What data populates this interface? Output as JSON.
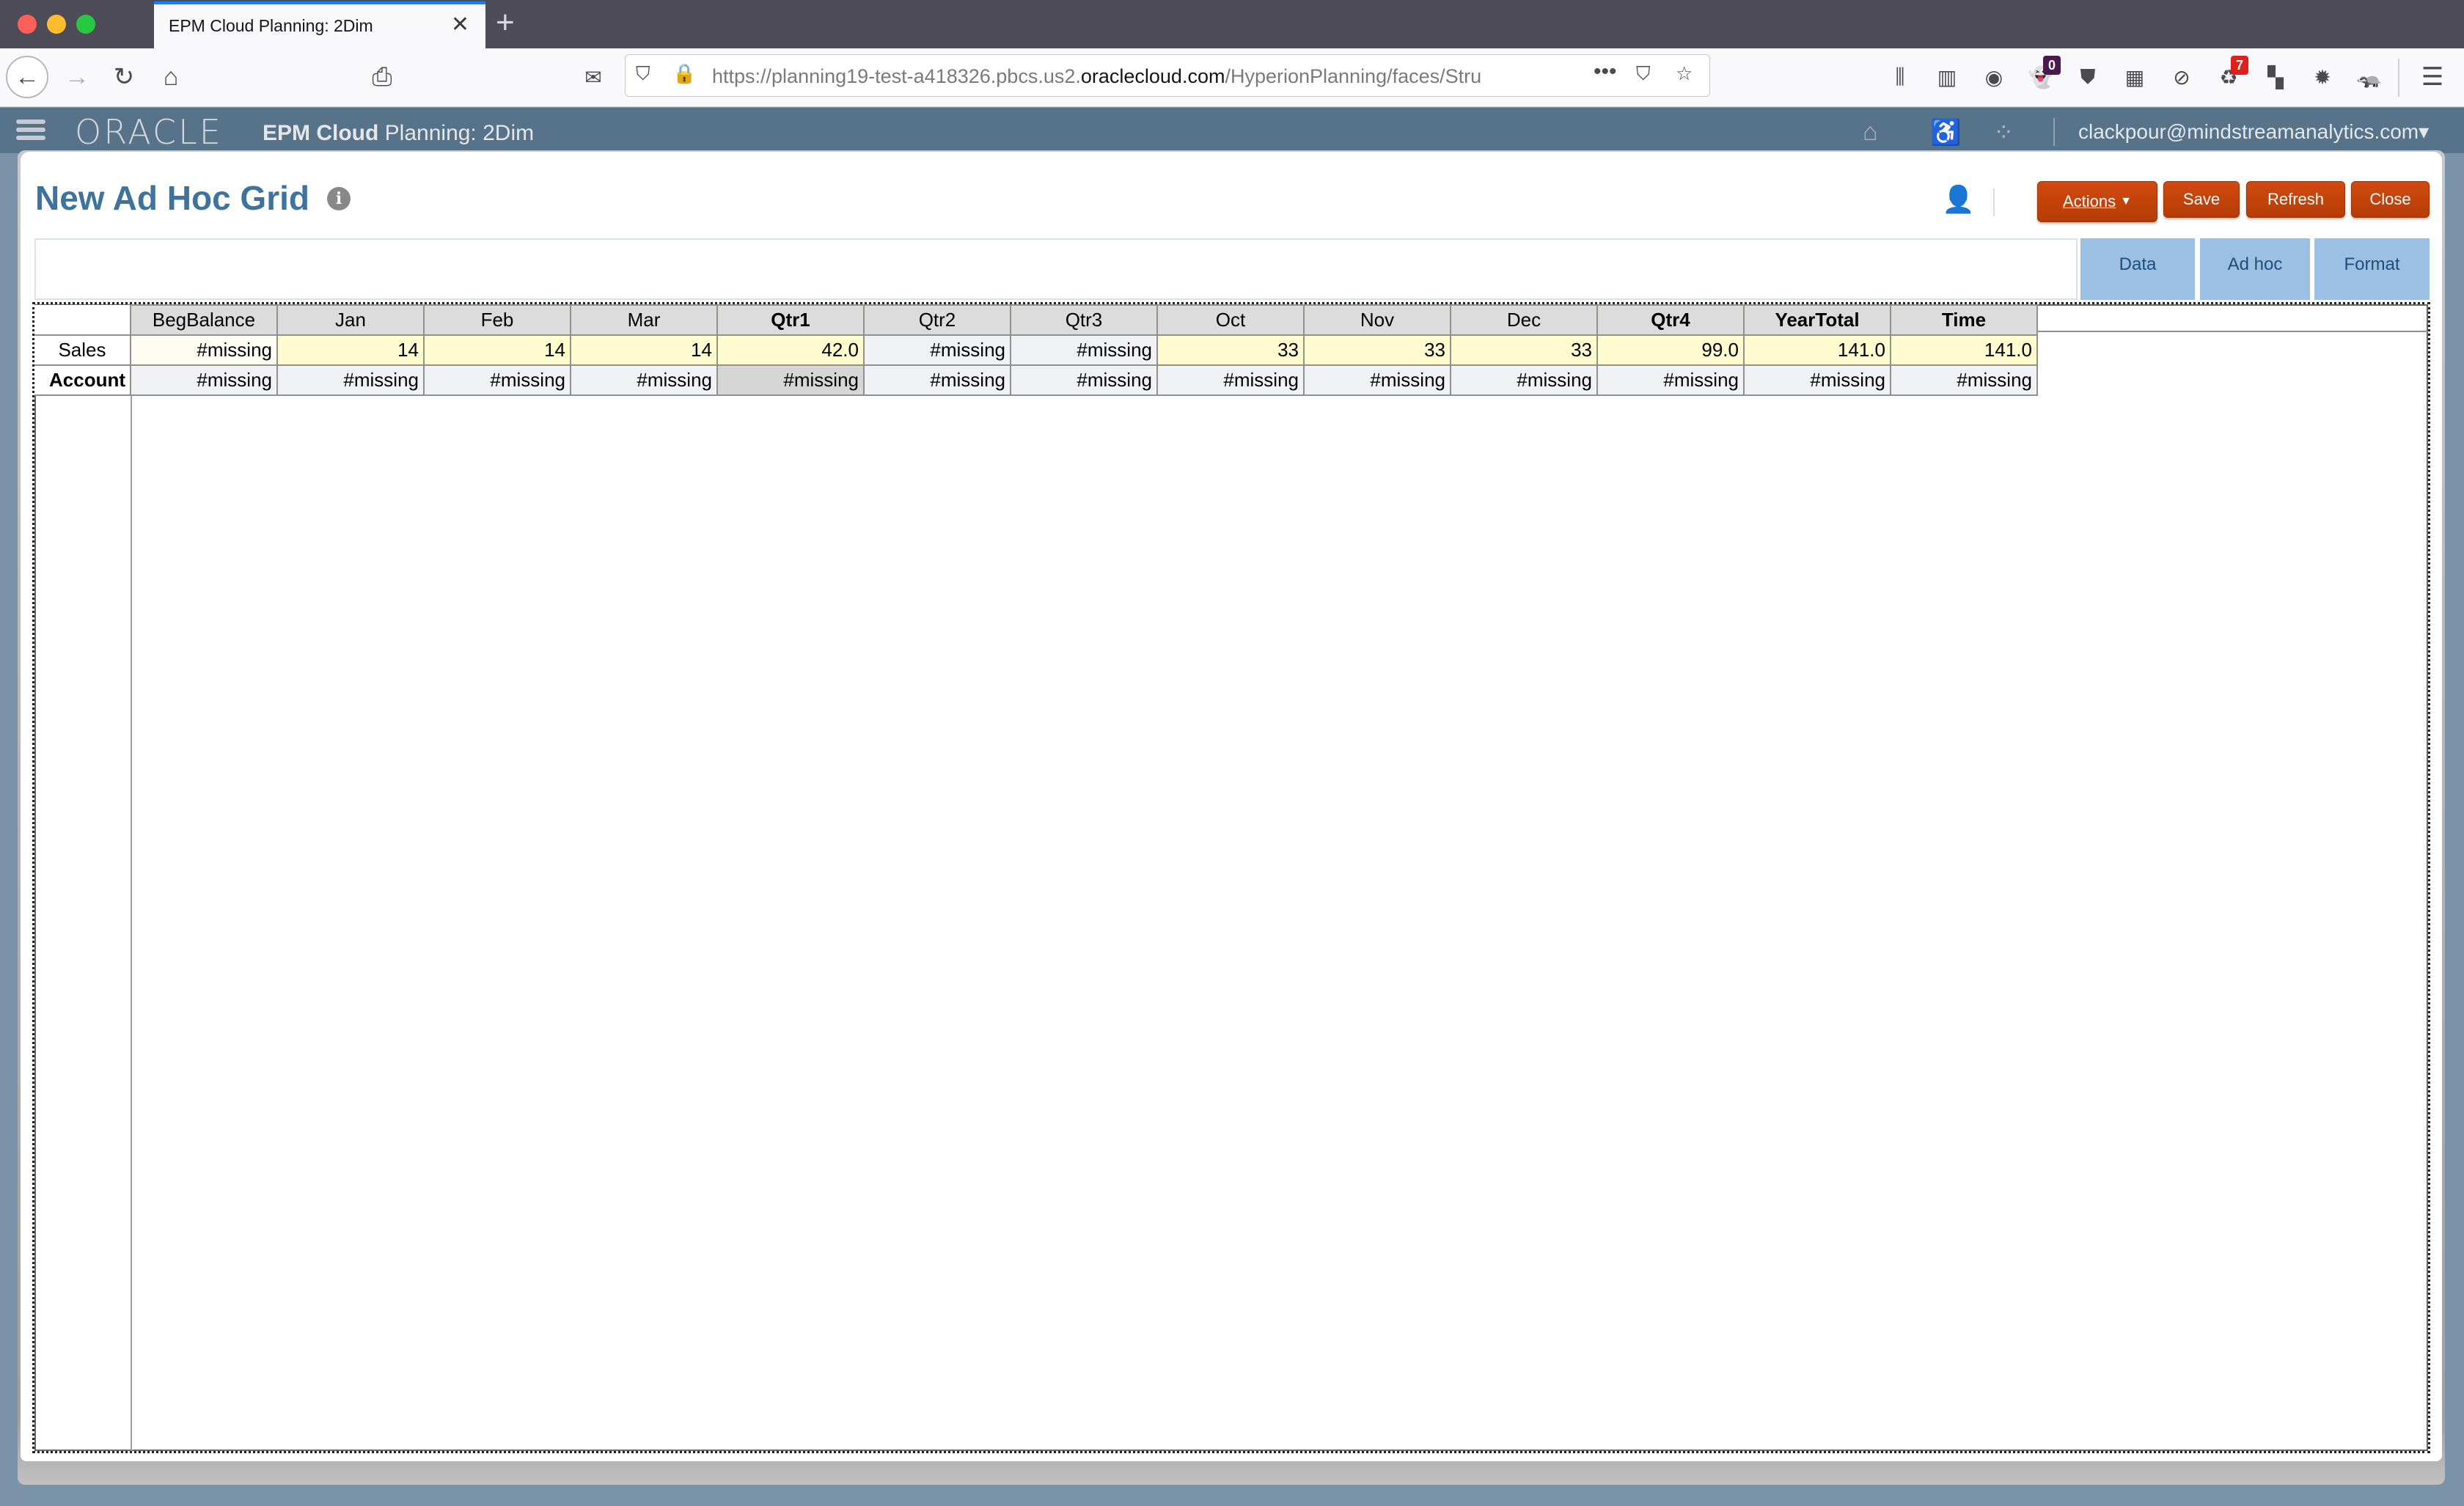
{
  "browser": {
    "tab_title": "EPM Cloud Planning: 2Dim",
    "url_prefix": "https://planning19-test-a418326.pbcs.us2.",
    "url_domain": "oraclecloud.com",
    "url_suffix": "/HyperionPlanning/faces/Stru",
    "extensions": [
      {
        "name": "library-icon",
        "glyph": "⫼"
      },
      {
        "name": "sidebar-icon",
        "glyph": "▥"
      },
      {
        "name": "account-icon",
        "glyph": "◉"
      },
      {
        "name": "ghostery-icon",
        "glyph": "👻",
        "badge": "0",
        "badge_color": "#4a1a4f"
      },
      {
        "name": "ublock-icon",
        "glyph": "⛊"
      },
      {
        "name": "sheets-icon",
        "glyph": "▦"
      },
      {
        "name": "video-blocker-icon",
        "glyph": "⊘"
      },
      {
        "name": "recycle-icon",
        "glyph": "♻",
        "badge": "7",
        "badge_color": "#e0201c"
      },
      {
        "name": "apps-add-icon",
        "glyph": "▚"
      },
      {
        "name": "settings-icon",
        "glyph": "✹"
      },
      {
        "name": "privacy-badger-icon",
        "glyph": "🦡"
      }
    ]
  },
  "header": {
    "logo": "ORACLE",
    "app_bold": "EPM Cloud",
    "app_name": "Planning: 2Dim",
    "user": "clackpour@mindstreamanalytics.com",
    "user_caret": "▾"
  },
  "page": {
    "title": "New Ad Hoc Grid",
    "info_glyph": "i",
    "buttons": {
      "actions": "Actions",
      "save": "Save",
      "refresh": "Refresh",
      "close": "Close"
    },
    "side_tabs": {
      "data": "Data",
      "adhoc": "Ad hoc",
      "format": "Format"
    }
  },
  "grid": {
    "columns": [
      {
        "label": "BegBalance",
        "bold": false
      },
      {
        "label": "Jan",
        "bold": false
      },
      {
        "label": "Feb",
        "bold": false
      },
      {
        "label": "Mar",
        "bold": false
      },
      {
        "label": "Qtr1",
        "bold": true
      },
      {
        "label": "Qtr2",
        "bold": false
      },
      {
        "label": "Qtr3",
        "bold": false
      },
      {
        "label": "Oct",
        "bold": false
      },
      {
        "label": "Nov",
        "bold": false
      },
      {
        "label": "Dec",
        "bold": false
      },
      {
        "label": "Qtr4",
        "bold": true
      },
      {
        "label": "YearTotal",
        "bold": true
      },
      {
        "label": "Time",
        "bold": true
      }
    ],
    "rows": [
      {
        "label": "Sales",
        "bold": false,
        "cells": [
          "#missing",
          "14",
          "14",
          "14",
          "42.0",
          "#missing",
          "#missing",
          "33",
          "33",
          "33",
          "99.0",
          "141.0",
          "141.0"
        ]
      },
      {
        "label": "Account",
        "bold": true,
        "cells": [
          "#missing",
          "#missing",
          "#missing",
          "#missing",
          "#missing",
          "#missing",
          "#missing",
          "#missing",
          "#missing",
          "#missing",
          "#missing",
          "#missing",
          "#missing"
        ]
      }
    ]
  }
}
